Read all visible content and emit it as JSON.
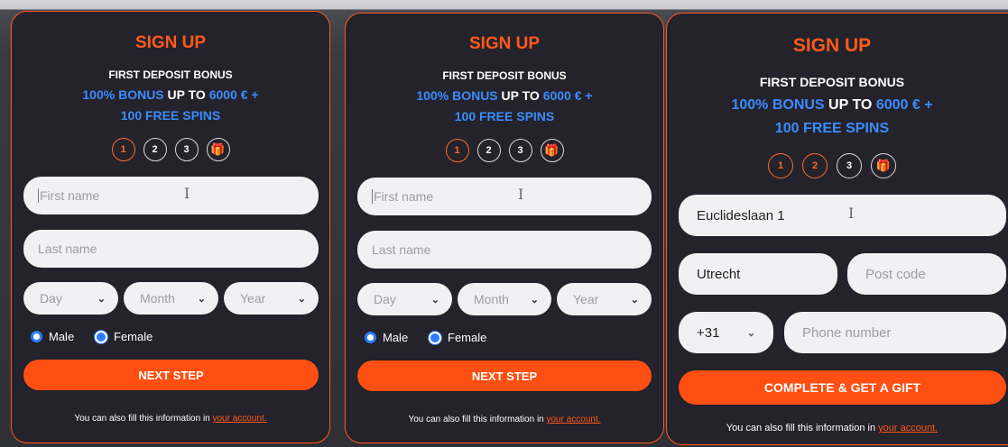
{
  "forms": [
    {
      "title": "SIGN UP",
      "bonus_heading": "FIRST DEPOSIT BONUS",
      "bonus_blue_1": "100% BONUS",
      "bonus_white": " UP TO ",
      "bonus_blue_2": " 6000 € +",
      "bonus_line_2": "100 FREE SPINS",
      "steps": [
        "1",
        "2",
        "3"
      ],
      "first_name_placeholder": "First name",
      "last_name_placeholder": "Last name",
      "day_label": "Day",
      "month_label": "Month",
      "year_label": "Year",
      "male_label": "Male",
      "female_label": "Female",
      "button_label": "NEXT STEP",
      "footer_text": "You can also fill this information in ",
      "footer_link": "your account."
    },
    {
      "title": "SIGN UP",
      "bonus_heading": "FIRST DEPOSIT BONUS",
      "bonus_blue_1": "100% BONUS",
      "bonus_white": " UP TO ",
      "bonus_blue_2": " 6000 € +",
      "bonus_line_2": "100 FREE SPINS",
      "steps": [
        "1",
        "2",
        "3"
      ],
      "first_name_placeholder": "First name",
      "last_name_placeholder": "Last name",
      "day_label": "Day",
      "month_label": "Month",
      "year_label": "Year",
      "male_label": "Male",
      "female_label": "Female",
      "button_label": "NEXT STEP",
      "footer_text": "You can also fill this information in ",
      "footer_link": "your account."
    },
    {
      "title": "SIGN UP",
      "bonus_heading": "FIRST DEPOSIT BONUS",
      "bonus_blue_1": "100% BONUS",
      "bonus_white": " UP TO ",
      "bonus_blue_2": " 6000 € +",
      "bonus_line_2": "100 FREE SPINS",
      "steps": [
        "1",
        "2",
        "3"
      ],
      "address_value": "Euclideslaan 1",
      "city_value": "Utrecht",
      "postcode_placeholder": "Post code",
      "phone_code": "+31",
      "phone_placeholder": "Phone number",
      "button_label": "COMPLETE & GET A GIFT",
      "footer_text": "You can also fill this information in ",
      "footer_link": "your account."
    }
  ],
  "icons": {
    "gift": "gift-icon",
    "chevron": "chevron-down-icon",
    "text_cursor": "text-cursor-icon"
  },
  "colors": {
    "accent": "#ff5a1a",
    "blue": "#3b8cff",
    "panel_bg": "#24222a",
    "field_bg": "#f1f0f2"
  }
}
